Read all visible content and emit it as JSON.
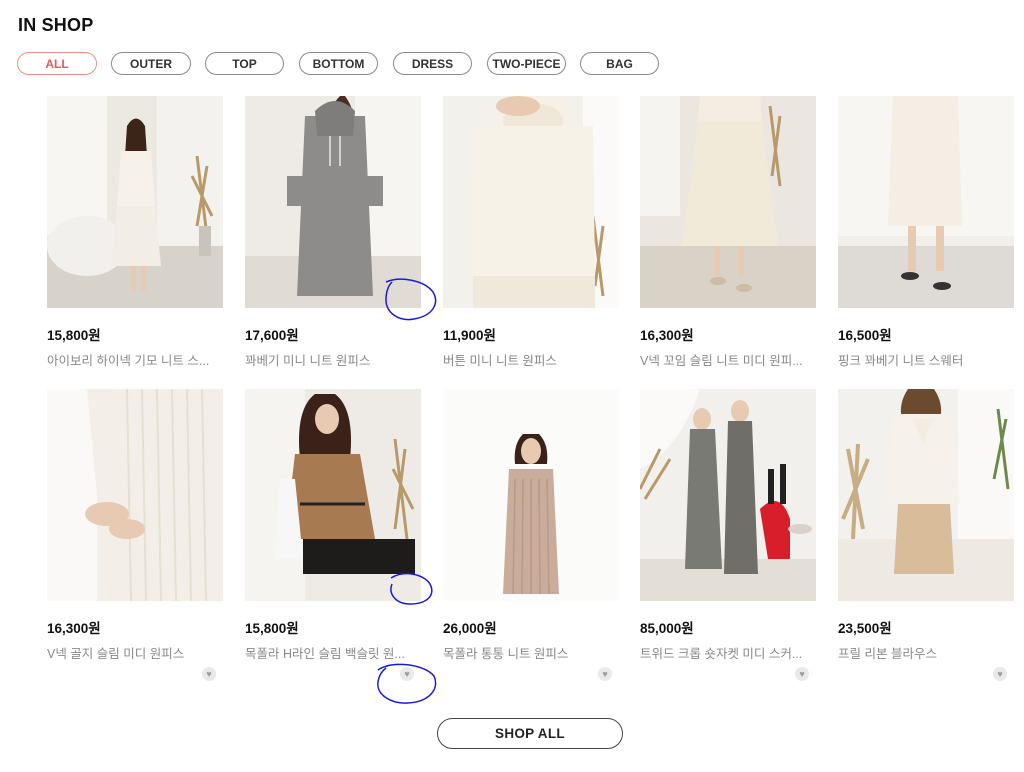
{
  "section_title": "IN SHOP",
  "filters": [
    "ALL",
    "OUTER",
    "TOP",
    "BOTTOM",
    "DRESS",
    "TWO-PIECE",
    "BAG"
  ],
  "active_filter": "ALL",
  "products": [
    {
      "price": "15,800원",
      "name": "아이보리 하이넥 기모 니트 스..."
    },
    {
      "price": "17,600원",
      "name": "꽈베기 미니 니트 원피스"
    },
    {
      "price": "11,900원",
      "name": "버튼 미니 니트 원피스"
    },
    {
      "price": "16,300원",
      "name": "V넥 꼬임 슬림 니트 미디 원피..."
    },
    {
      "price": "16,500원",
      "name": "핑크 꽈베기 니트 스웨터"
    },
    {
      "price": "16,300원",
      "name": "V넥 골지 슬림 미디 원피스"
    },
    {
      "price": "15,800원",
      "name": "목폴라 H라인 슬림 백슬릿 원..."
    },
    {
      "price": "26,000원",
      "name": "목폴라 통통 니트 원피스"
    },
    {
      "price": "85,000원",
      "name": "트위드 크롭 숏자켓 미디 스커..."
    },
    {
      "price": "23,500원",
      "name": "프릴 리본 블라우스"
    }
  ],
  "wishlist_icon": "heart-icon",
  "shop_all_label": "SHOP ALL",
  "colors": {
    "accent": "#e8585a",
    "accent_border": "#f08b8b",
    "annotation": "#1a1adb"
  }
}
